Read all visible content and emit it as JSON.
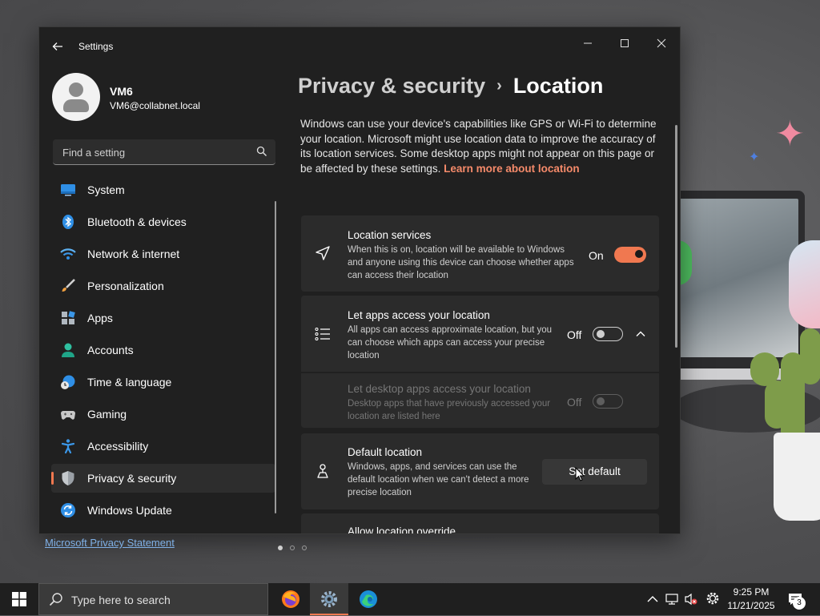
{
  "window": {
    "app_title": "Settings",
    "back_icon": "arrow-left-icon",
    "controls": [
      "minimize-icon",
      "maximize-icon",
      "close-icon"
    ]
  },
  "user": {
    "name": "VM6",
    "email": "VM6@collabnet.local"
  },
  "search": {
    "placeholder": "Find a setting"
  },
  "sidebar": {
    "items": [
      {
        "label": "System",
        "icon": "monitor-icon",
        "active": false
      },
      {
        "label": "Bluetooth & devices",
        "icon": "bluetooth-icon",
        "active": false
      },
      {
        "label": "Network & internet",
        "icon": "wifi-icon",
        "active": false
      },
      {
        "label": "Personalization",
        "icon": "brush-icon",
        "active": false
      },
      {
        "label": "Apps",
        "icon": "apps-icon",
        "active": false
      },
      {
        "label": "Accounts",
        "icon": "person-icon",
        "active": false
      },
      {
        "label": "Time & language",
        "icon": "globe-clock-icon",
        "active": false
      },
      {
        "label": "Gaming",
        "icon": "gamepad-icon",
        "active": false
      },
      {
        "label": "Accessibility",
        "icon": "accessibility-icon",
        "active": false
      },
      {
        "label": "Privacy & security",
        "icon": "shield-icon",
        "active": true
      },
      {
        "label": "Windows Update",
        "icon": "update-icon",
        "active": false
      }
    ]
  },
  "main": {
    "breadcrumb_parent": "Privacy & security",
    "breadcrumb_separator": "›",
    "breadcrumb_current": "Location",
    "description": "Windows can use your device's capabilities like GPS or Wi-Fi to determine your location. Microsoft might use location data to improve the accuracy of its location services. Some desktop apps might not appear on this page or be affected by these settings.",
    "learn_more": "Learn more about location",
    "cards": {
      "location_services": {
        "title": "Location services",
        "desc": "When this is on, location will be available to Windows and anyone using this device can choose whether apps can access their location",
        "state_label": "On",
        "state": true,
        "icon": "navigation-arrow-icon"
      },
      "apps_access": {
        "title": "Let apps access your location",
        "desc": "All apps can access approximate location, but you can choose which apps can access your precise location",
        "state_label": "Off",
        "state": false,
        "icon": "list-icon",
        "expand_icon": "chevron-up-icon"
      },
      "desktop_apps": {
        "title": "Let desktop apps access your location",
        "desc": "Desktop apps that have previously accessed your location are listed here",
        "state_label": "Off",
        "state": false,
        "disabled": true
      },
      "default_location": {
        "title": "Default location",
        "desc": "Windows, apps, and services can use the default location when we can't detect a more precise location",
        "button_label": "Set default",
        "icon": "person-pin-icon"
      },
      "override": {
        "title": "Allow location override"
      }
    }
  },
  "footer": {
    "privacy_link": "Microsoft Privacy Statement"
  },
  "taskbar": {
    "search_placeholder": "Type here to search",
    "apps": [
      "firefox-icon",
      "settings-gear-icon",
      "edge-icon"
    ],
    "tray_icons": [
      "chevron-up-icon",
      "network-icon",
      "volume-muted-icon",
      "gear-icon"
    ],
    "time": "9:25 PM",
    "date": "11/21/2025",
    "notification_count": "3"
  },
  "colors": {
    "accent": "#f07850",
    "window_bg": "#202020",
    "card_bg": "#2b2b2b",
    "link": "#f58a6a"
  }
}
